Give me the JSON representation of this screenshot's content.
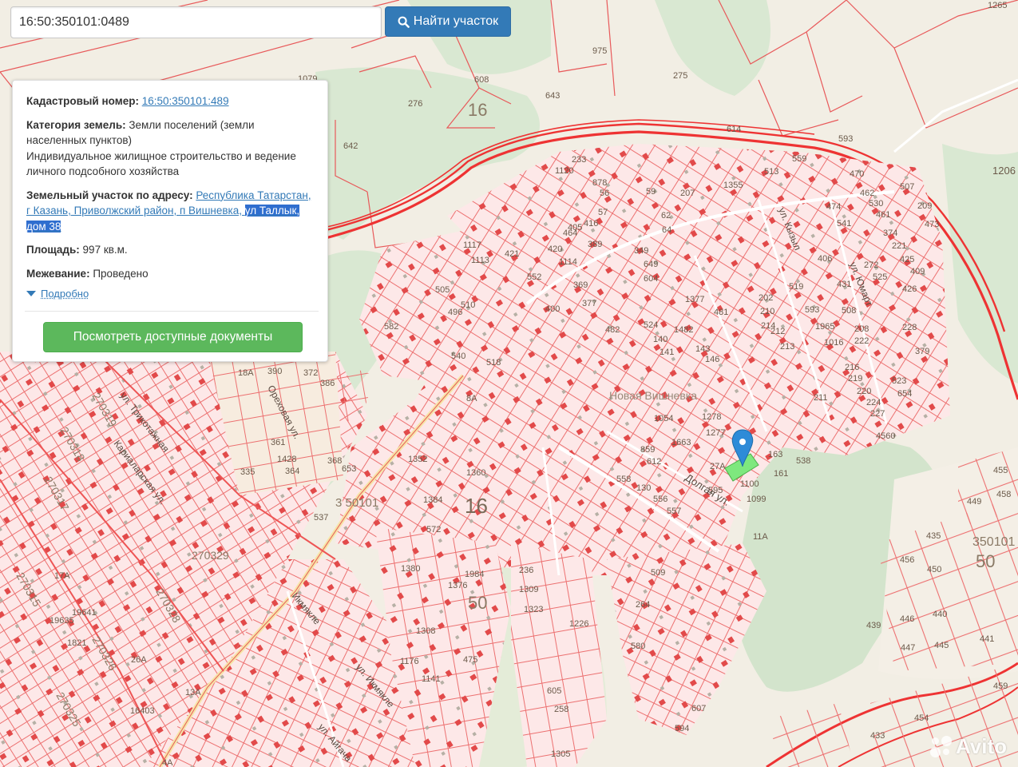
{
  "search": {
    "value": "16:50:350101:0489",
    "button_label": "Найти участок"
  },
  "parcel": {
    "cadastral_label": "Кадастровый номер:",
    "cadastral_value": "16:50:350101:489",
    "category_label": "Категория земель:",
    "category_value": "Земли поселений (земли населенных пунктов)",
    "use_value": "Индивидуальное жилищное строительство и ведение личного подсобного хозяйства",
    "address_label": "Земельный участок по адресу:",
    "address_part1": "Республика Татарстан, г Казань, Приволжский район, п Вишневка,",
    "address_part2": "ул Таллык, дом 38",
    "area_label": "Площадь:",
    "area_value": "997 кв.м.",
    "survey_label": "Межевание:",
    "survey_value": "Проведено",
    "details_link": "Подробно",
    "docs_button": "Посмотреть доступные документы"
  },
  "map": {
    "background_color": "#f2eee4",
    "parcel_line_color": "#e8595a",
    "road_color": "#ee3333",
    "highlight_color": "#7ee87e",
    "marker_color": "#2e8bd8",
    "large_labels": [
      "16",
      "16",
      "50",
      "50",
      "350101"
    ],
    "parcel_numbers": [
      "975",
      "275",
      "1265",
      "608",
      "643",
      "614",
      "642",
      "593",
      "1206",
      "1079",
      "276",
      "582",
      "335",
      "1226",
      "475",
      "1305",
      "433",
      "454",
      "459",
      "455",
      "458",
      "449",
      "441",
      "445",
      "447",
      "446",
      "439",
      "440",
      "435",
      "450",
      "456",
      "1984",
      "1376",
      "236",
      "1309",
      "1323",
      "258",
      "605",
      "594",
      "607",
      "509",
      "264",
      "580",
      "1100",
      "1099",
      "163",
      "161",
      "27A",
      "595",
      "538",
      "4560",
      "400",
      "377",
      "369",
      "482",
      "1054",
      "1663",
      "1278",
      "1277",
      "1377",
      "481",
      "202",
      "210",
      "212",
      "213",
      "214",
      "211",
      "220",
      "224",
      "227",
      "228",
      "222",
      "216",
      "219",
      "221",
      "425",
      "426",
      "409",
      "379",
      "523",
      "654",
      "530",
      "462",
      "461",
      "470",
      "513",
      "559",
      "507",
      "209",
      "473",
      "474",
      "541",
      "374",
      "208",
      "1016",
      "1965",
      "406",
      "593",
      "519",
      "431",
      "508",
      "525",
      "272",
      "207",
      "1355",
      "878",
      "56",
      "57",
      "59",
      "62",
      "64",
      "349",
      "649",
      "604",
      "524",
      "140",
      "141",
      "143",
      "146",
      "1482",
      "859",
      "612",
      "130",
      "556",
      "557",
      "558",
      "572",
      "1360",
      "1352",
      "1384",
      "1380",
      "1308",
      "1176",
      "1141",
      "233",
      "1120",
      "1117",
      "1113",
      "1114",
      "389",
      "416",
      "405",
      "420",
      "464",
      "421",
      "552",
      "496",
      "510",
      "518",
      "505",
      "540",
      "372",
      "386",
      "390",
      "361",
      "1428",
      "364",
      "368",
      "653",
      "537",
      "26A",
      "17A",
      "11A",
      "18A",
      "8A",
      "4A",
      "13A",
      "16403",
      "1821",
      "19635",
      "19641",
      "21163",
      "21165"
    ],
    "street_labels": [
      "ул. Икмякле",
      "Икмякле",
      "Долгая ул.",
      "ул. Юмарт",
      "ул. Кызыл",
      "Ореховая ул.",
      "Новая Вишневка",
      "ул. Айгача",
      "Кариаларская ул.",
      "ул. Трикотажная"
    ],
    "quarter_labels": [
      "270318",
      "270317",
      "270315",
      "270319",
      "270329",
      "270326",
      "270328",
      "270325",
      "3 50101"
    ]
  },
  "watermark": {
    "text": "Avito"
  }
}
